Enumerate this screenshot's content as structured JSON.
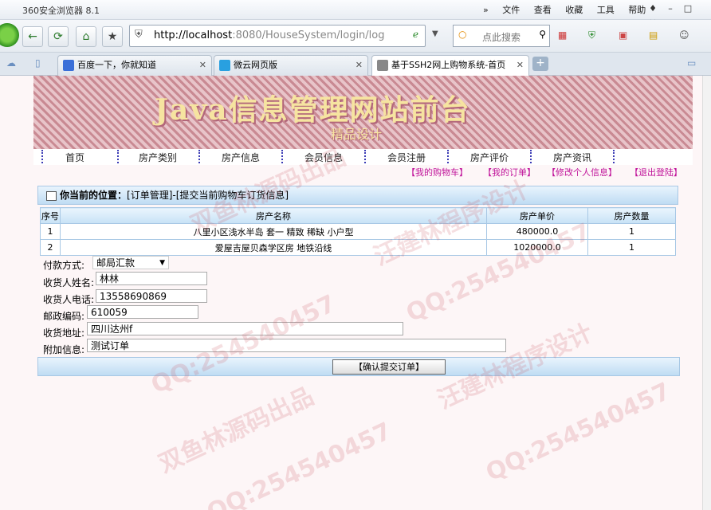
{
  "browser": {
    "app_title": "360安全浏览器 8.1",
    "menu": [
      "文件",
      "查看",
      "收藏",
      "工具",
      "帮助"
    ],
    "url_host": "http://localhost",
    "url_rest": ":8080/HouseSystem/login/log",
    "search_placeholder": "点此搜索",
    "tabs": [
      {
        "label": "百度一下，你就知道",
        "active": false
      },
      {
        "label": "微云网页版",
        "active": false
      },
      {
        "label": "基于SSH2网上购物系统-首页",
        "active": true
      }
    ]
  },
  "site": {
    "banner_title": "Java信息管理网站前台",
    "banner_subtitle": "精品设计",
    "nav": [
      "首页",
      "房产类别",
      "房产信息",
      "会员信息",
      "会员注册",
      "房产评价",
      "房产资讯"
    ],
    "user_links": [
      "【我的购物车】",
      "【我的订单】",
      "【修改个人信息】",
      "【退出登陆】"
    ]
  },
  "main": {
    "location_label": "你当前的位置：",
    "location_path": "[订单管理]-[提交当前购物车订货信息]",
    "table": {
      "headers": [
        "序号",
        "房产名称",
        "房产单价",
        "房产数量"
      ],
      "rows": [
        [
          "1",
          "八里小区浅水半岛 套一 精致 稀缺 小户型",
          "480000.0",
          "1"
        ],
        [
          "2",
          "爱屋吉屋贝森学区房 地铁沿线",
          "1020000.0",
          "1"
        ]
      ]
    },
    "form": {
      "payment_label": "付款方式:",
      "payment_value": "邮局汇款",
      "name_label": "收货人姓名:",
      "name_value": "林林",
      "phone_label": "收货人电话:",
      "phone_value": "13558690869",
      "zip_label": "邮政编码:",
      "zip_value": "610059",
      "address_label": "收货地址:",
      "address_value": "四川达州f",
      "note_label": "附加信息:",
      "note_value": "测试订单"
    },
    "submit_label": "【确认提交订单】"
  },
  "watermarks": [
    "QQ:254540457",
    "双鱼林源码出品",
    "汪建林程序设计"
  ]
}
